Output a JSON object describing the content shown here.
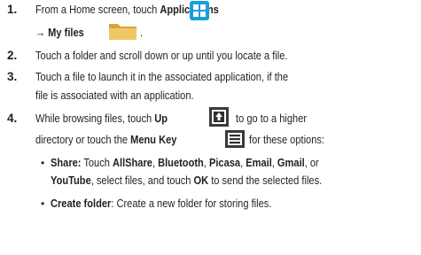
{
  "steps": [
    {
      "number": "1.",
      "line1": {
        "pre": "From a Home screen, touch ",
        "bold": "Applications"
      },
      "line2": {
        "arrow": "→",
        "bold": "My files",
        "post": "."
      }
    },
    {
      "number": "2.",
      "text": "Touch a folder and scroll down or up until you locate a file."
    },
    {
      "number": "3.",
      "line1": "Touch a file to launch it in the associated application, if the",
      "line2": "file is associated with an application."
    },
    {
      "number": "4.",
      "line1": {
        "pre": "While browsing files, touch ",
        "bold": "Up",
        "post": "to go to a higher"
      },
      "line2": {
        "pre": "directory or touch the ",
        "bold": "Menu Key",
        "post": "for these options:"
      },
      "bullets": [
        {
          "line1": {
            "t1": "Share:",
            "t2": " Touch ",
            "t3": "AllShare",
            "t4": ", ",
            "t5": "Bluetooth",
            "t6": ", ",
            "t7": "Picasa",
            "t8": ", ",
            "t9": "Email",
            "t10": ", ",
            "t11": "Gmail",
            "t12": ", or"
          },
          "line2": {
            "t1": "YouTube",
            "t2": ", select files, and touch ",
            "t3": "OK",
            "t4": " to send the selected files."
          }
        },
        {
          "line1": {
            "t1": "Create folder",
            "t2": ": Create a new folder for storing files."
          }
        }
      ]
    }
  ],
  "bullet_glyph": "•",
  "colors": {
    "text": "#231f20",
    "apps_icon": "#1a9fd9",
    "folder_icon": "#e7b94e",
    "gray_icon": "#3a3a3a"
  }
}
